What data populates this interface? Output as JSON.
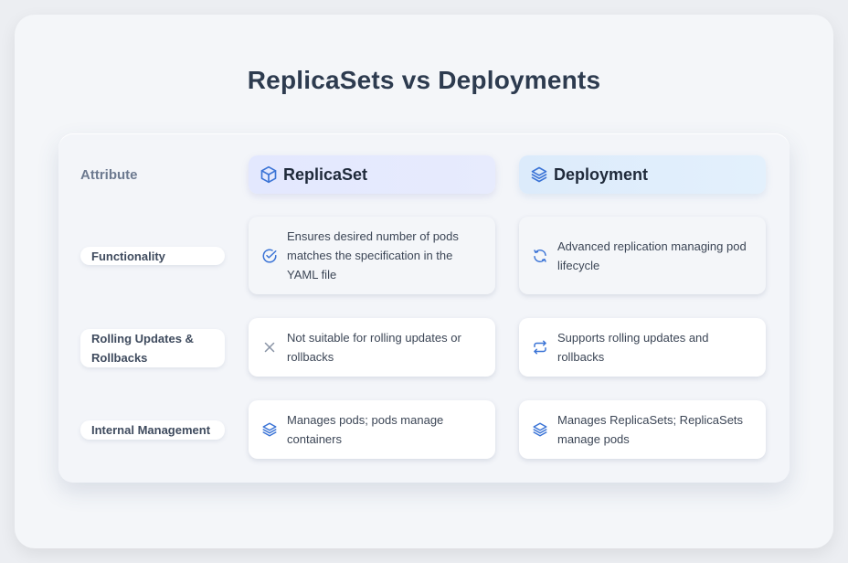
{
  "title": "ReplicaSets vs Deployments",
  "header": {
    "attribute_label": "Attribute",
    "replicaset_label": "ReplicaSet",
    "replicaset_icon": "cube-icon",
    "deployment_label": "Deployment",
    "deployment_icon": "layers-icon"
  },
  "rows": [
    {
      "attribute": "Functionality",
      "replicaset": {
        "text": "Ensures desired number of pods matches the specification in the YAML file",
        "icon": "check-circle-icon"
      },
      "deployment": {
        "text": "Advanced replication managing pod lifecycle",
        "icon": "refresh-icon"
      }
    },
    {
      "attribute": "Rolling Updates & Rollbacks",
      "replicaset": {
        "text": "Not suitable for rolling updates or rollbacks",
        "icon": "x-icon"
      },
      "deployment": {
        "text": "Supports rolling updates and rollbacks",
        "icon": "repeat-arrows-icon"
      }
    },
    {
      "attribute": "Internal Management",
      "replicaset": {
        "text": "Manages pods; pods manage containers",
        "icon": "layers-icon"
      },
      "deployment": {
        "text": "Manages ReplicaSets; ReplicaSets manage pods",
        "icon": "layers-icon"
      }
    }
  ],
  "colors": {
    "title": "#2d3b4f",
    "accent_blue": "#3b74d6",
    "muted_icon": "#8a94a6"
  }
}
